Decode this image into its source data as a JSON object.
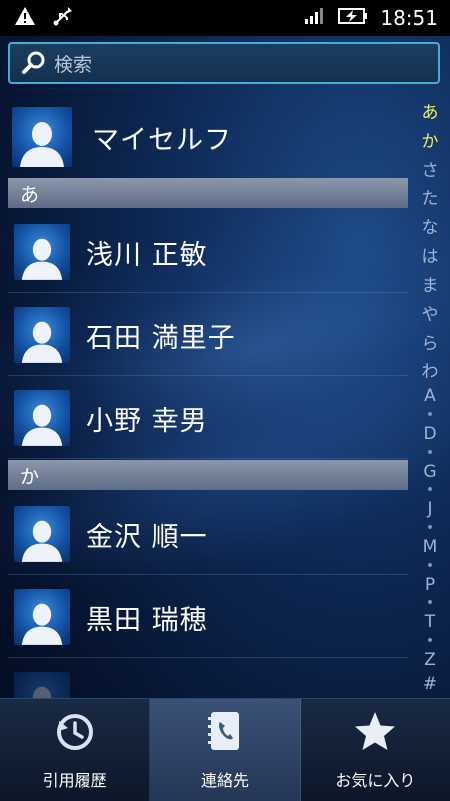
{
  "status_bar": {
    "time": "18:51",
    "icons": [
      "warning-icon",
      "usb-icon",
      "signal-icon",
      "battery-charging-icon"
    ]
  },
  "search": {
    "placeholder": "検索"
  },
  "self_contact": {
    "name": "マイセルフ"
  },
  "sections": [
    {
      "header": "あ",
      "contacts": [
        {
          "name": "浅川 正敏"
        },
        {
          "name": "石田 満里子"
        },
        {
          "name": "小野 幸男"
        }
      ]
    },
    {
      "header": "か",
      "contacts": [
        {
          "name": "金沢 順一"
        },
        {
          "name": "黒田 瑞穂"
        }
      ]
    }
  ],
  "index_bar": {
    "letters": [
      "あ",
      "か",
      "さ",
      "た",
      "な",
      "は",
      "ま",
      "や",
      "ら",
      "わ",
      "A",
      "•",
      "D",
      "•",
      "G",
      "•",
      "J",
      "•",
      "M",
      "•",
      "P",
      "•",
      "T",
      "•",
      "Z",
      "#"
    ],
    "current": [
      "あ",
      "か"
    ]
  },
  "bottom_tabs": [
    {
      "label": "引用履歴",
      "icon": "history-icon",
      "active": false
    },
    {
      "label": "連絡先",
      "icon": "contacts-book-icon",
      "active": true
    },
    {
      "label": "お気に入り",
      "icon": "star-icon",
      "active": false
    }
  ],
  "colors": {
    "search_border": "#3fb1cf",
    "index_highlight": "#e9ef6a",
    "section_header": "#7a869d"
  }
}
